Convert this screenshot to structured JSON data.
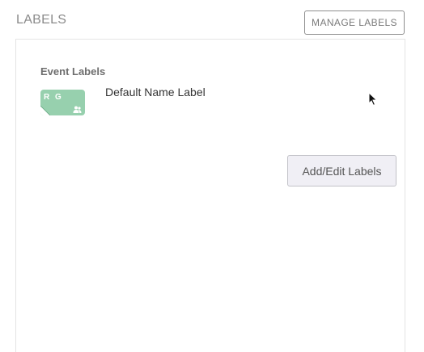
{
  "header": {
    "title": "LABELS",
    "manage_button_label": "MANAGE LABELS"
  },
  "panel": {
    "section_title": "Event Labels",
    "labels": [
      {
        "initials": "R G",
        "name": "Default Name Label",
        "color": "#97d0ae",
        "icons": [
          "folded-corner-icon",
          "people-icon"
        ]
      }
    ],
    "add_edit_button_label": "Add/Edit Labels"
  },
  "colors": {
    "label_green": "#97d0ae",
    "button_bg": "#f0eff5",
    "panel_border": "#e4e4e4"
  }
}
